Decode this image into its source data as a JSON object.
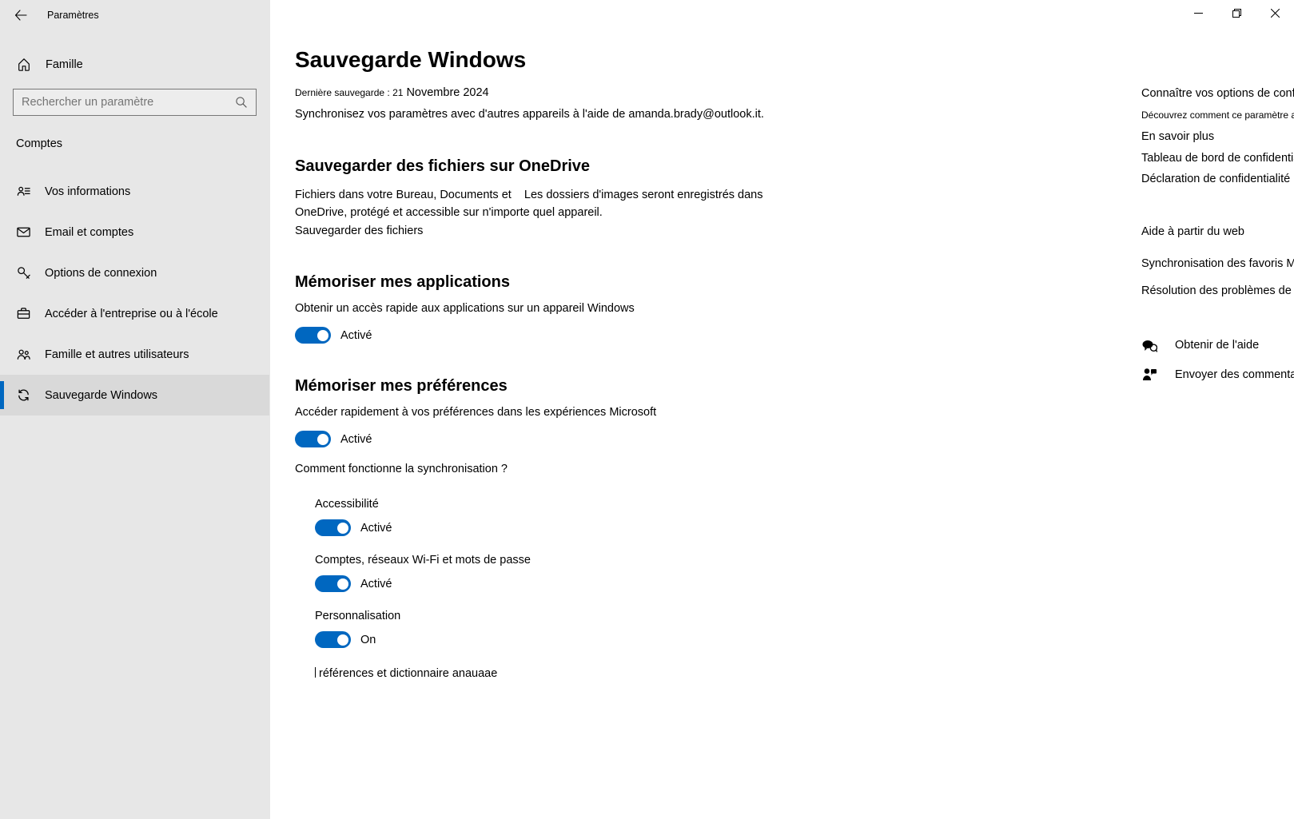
{
  "window": {
    "title": "Paramètres"
  },
  "sidebar": {
    "home": "Famille",
    "search_placeholder": "Rechercher un paramètre",
    "category": "Comptes",
    "items": [
      {
        "label": "Vos informations"
      },
      {
        "label": "Email et comptes"
      },
      {
        "label": "Options de connexion"
      },
      {
        "label": "Accéder à l'entreprise ou à l'école"
      },
      {
        "label": "Famille et autres utilisateurs"
      },
      {
        "label": "Sauvegarde Windows"
      }
    ]
  },
  "page": {
    "title": "Sauvegarde Windows",
    "last_backup_prefix": "Dernière sauvegarde : 21",
    "last_backup_suffix": " Novembre 2024",
    "sync_text": "Synchronisez vos paramètres avec d'autres appareils à l'aide de amanda.brady@outlook.it.",
    "onedrive": {
      "heading": "Sauvegarder des fichiers sur OneDrive",
      "text_a": "Fichiers dans votre Bureau, Documents et ",
      "text_b": "Les dossiers d'images seront enregistrés dans OneDrive, protégé et accessible sur n'importe quel appareil.",
      "link": "Sauvegarder des fichiers"
    },
    "apps": {
      "heading": "Mémoriser mes applications",
      "desc": "Obtenir un accès rapide aux applications sur un appareil Windows",
      "state": "Activé"
    },
    "prefs": {
      "heading": "Mémoriser mes préférences",
      "desc": "Accéder rapidement à vos préférences dans les expériences Microsoft",
      "state": "Activé",
      "how_link": "Comment fonctionne la synchronisation ?",
      "items": [
        {
          "title": "Accessibilité",
          "state": "Activé"
        },
        {
          "title": "Comptes, réseaux Wi-Fi et mots de passe",
          "state": "Activé"
        },
        {
          "title": "Personnalisation",
          "state": "On"
        }
      ],
      "truncated": "références et dictionnaire anauaae"
    }
  },
  "rail": {
    "privacy": {
      "heading": "Connaître vos options de confidentialité",
      "text": "Découvrez comment ce paramètre a un impact sur votre confidentialité.",
      "links": [
        "En savoir plus",
        "Tableau de bord de confidentialité",
        "Déclaration de confidentialité"
      ]
    },
    "webhelp": {
      "heading": "Aide à partir du web",
      "links": [
        "Synchronisation des favoris Microsoft Edge",
        "Résolution des problèmes de Synchronisation OneDrive"
      ]
    },
    "actions": {
      "help": "Obtenir de l'aide",
      "feedback": "Envoyer des commentaires"
    }
  }
}
